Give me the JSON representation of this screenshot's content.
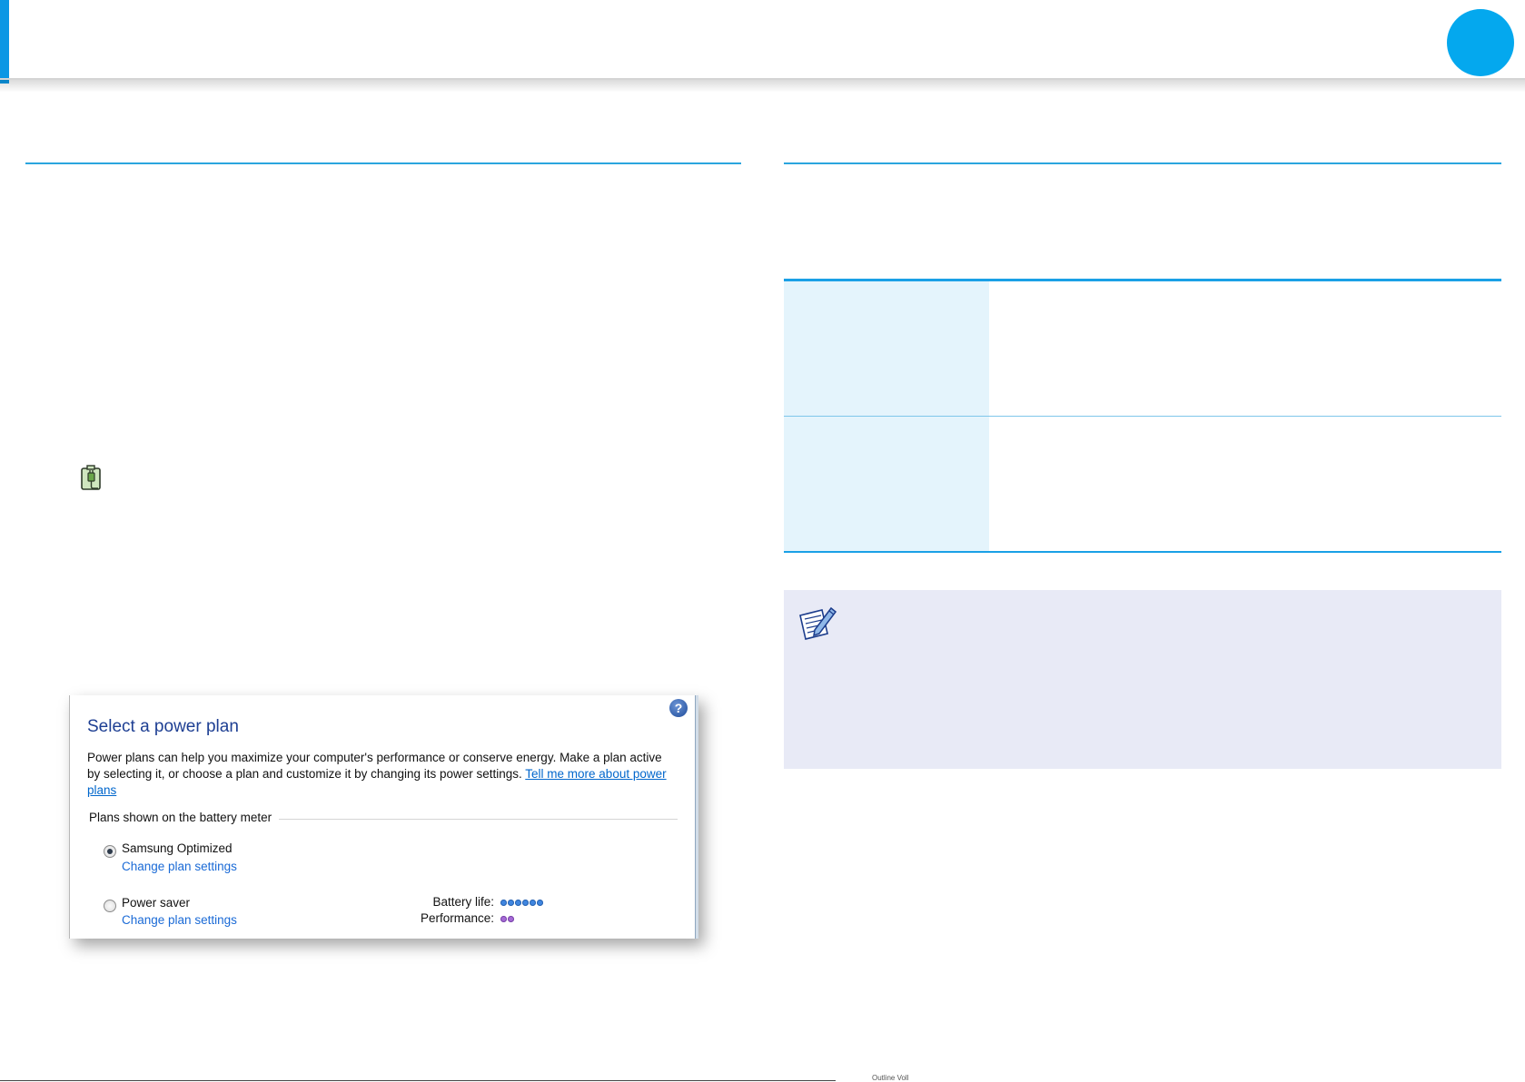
{
  "header": {
    "chapter_dot_color": "#04a8ee",
    "accent_color": "#0b97e4"
  },
  "icons": {
    "plug": "battery-plug-icon",
    "note": "note-pencil-icon",
    "help": "help-icon"
  },
  "screenshot": {
    "title": "Select a power plan",
    "description": "Power plans can help you maximize your computer's performance or conserve energy. Make a plan active by selecting it, or choose a plan and customize it by changing its power settings.",
    "description_link": "Tell me more about power plans",
    "help_glyph": "?",
    "group_label": "Plans shown on the battery meter",
    "plans": [
      {
        "name": "Samsung Optimized",
        "link": "Change plan settings",
        "selected": true
      },
      {
        "name": "Power saver",
        "link": "Change plan settings",
        "selected": false
      }
    ],
    "meter": {
      "battery_label": "Battery life:",
      "battery_level": 6,
      "performance_label": "Performance:",
      "performance_level": 2
    }
  },
  "footer": {
    "text": "Outline Voll"
  }
}
